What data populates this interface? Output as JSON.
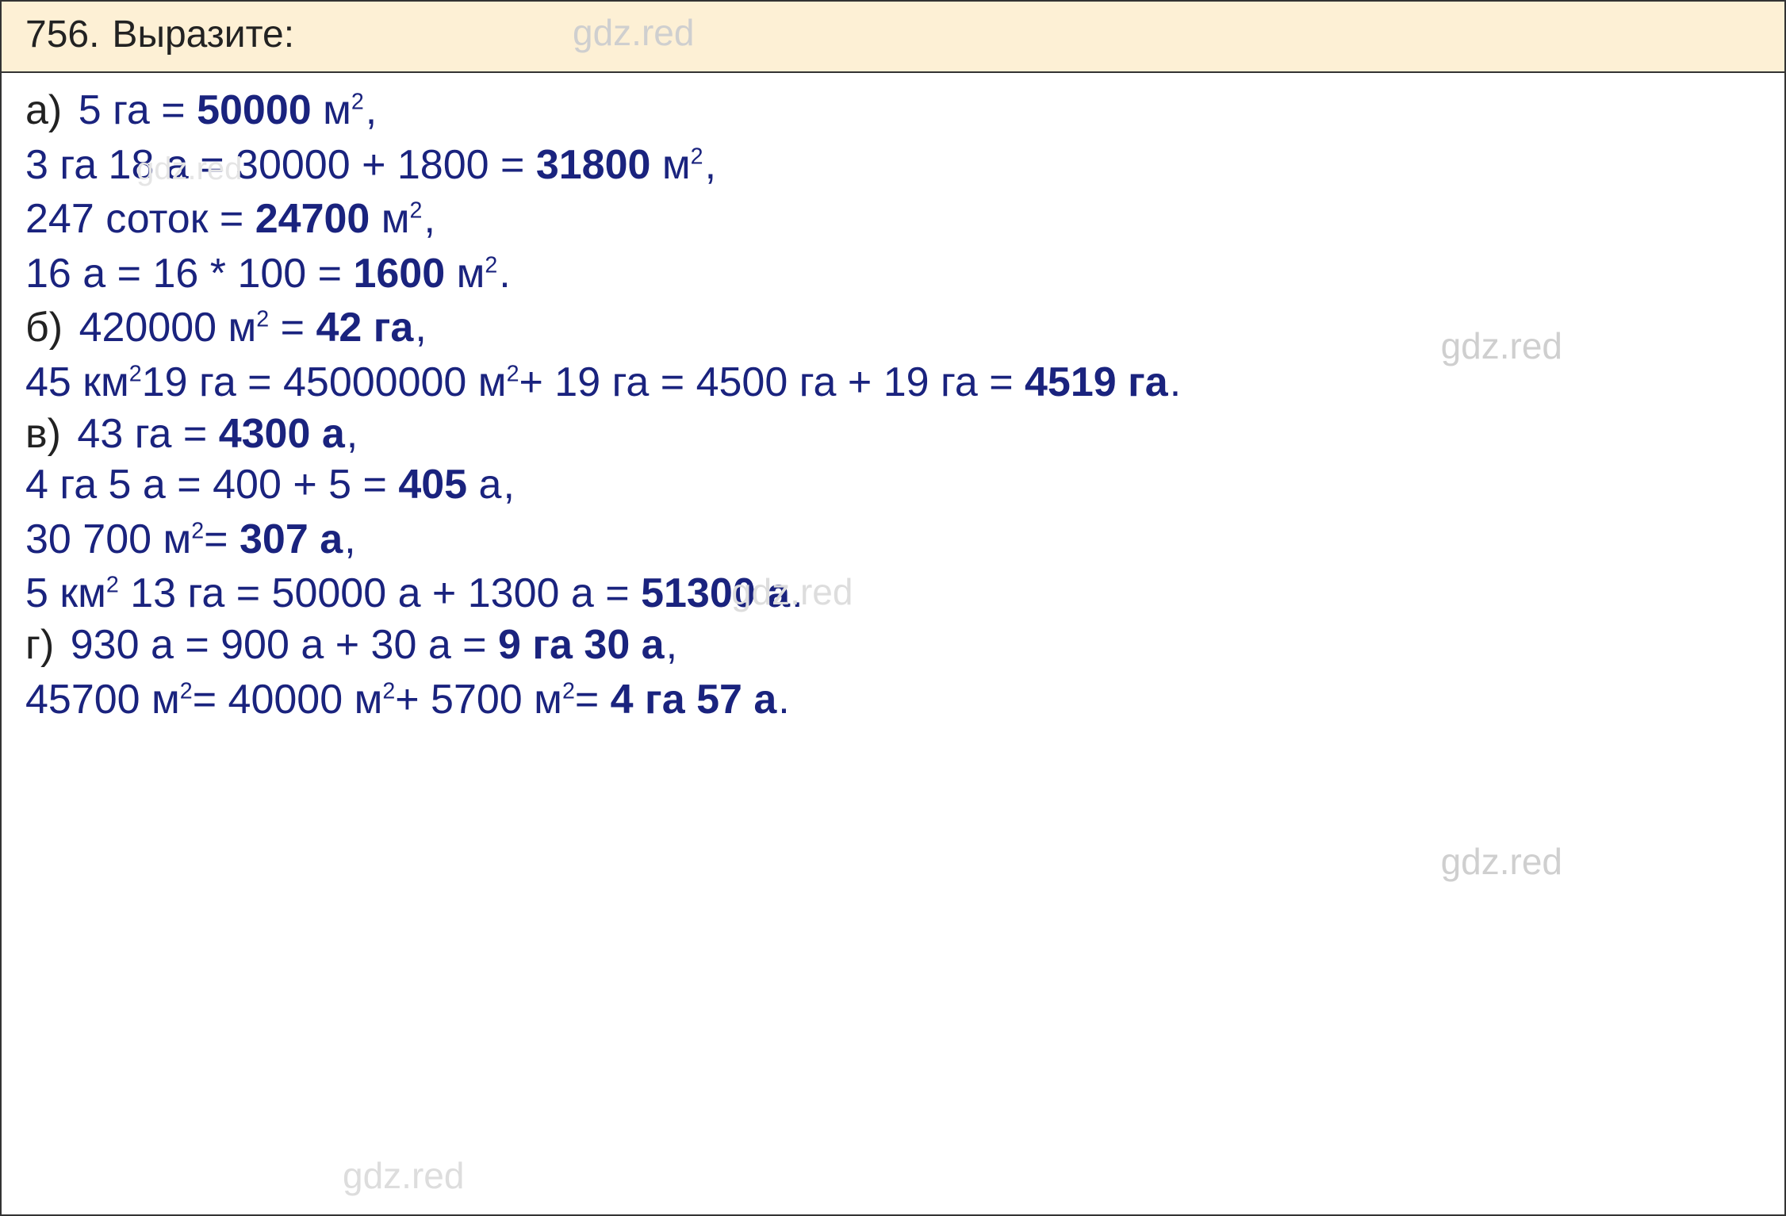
{
  "watermark": "gdz.red",
  "header": {
    "number": "756.",
    "title": "Выразите:"
  },
  "lines": {
    "a1_label": "а)",
    "a1": "5 га = ",
    "a1_bold": "50000",
    "a1_tail": " м",
    "a1_sup": "2",
    "a1_end": ",",
    "a2": "3 га 18 а = 30000 + 1800 = ",
    "a2_bold": "31800",
    "a2_tail": " м",
    "a2_sup": "2",
    "a2_end": ",",
    "a3": "247 соток = ",
    "a3_bold": "24700",
    "a3_tail": " м",
    "a3_sup": "2",
    "a3_end": ",",
    "a4": "16 а = 16 * 100 = ",
    "a4_bold": "1600",
    "a4_tail": " м",
    "a4_sup": "2",
    "a4_end": ".",
    "b1_label": "б)",
    "b1": "420000 м",
    "b1_sup": "2",
    "b1_mid": " = ",
    "b1_bold": "42 га",
    "b1_end": ",",
    "b2": "45 км",
    "b2_sup": "2",
    "b2_mid": "19 га = 45000000 м",
    "b2_sup2": "2",
    "b2_mid2": "+ 19 га = 4500 га + 19 га = ",
    "b2_bold": "4519 га",
    "b2_end": ".",
    "c1_label": "в)",
    "c1": "43 га = ",
    "c1_bold": "4300 а",
    "c1_end": ",",
    "c2": "4 га 5 а = 400 + 5 = ",
    "c2_bold": "405",
    "c2_tail": " а",
    "c2_end": ",",
    "c3": "30 700 м",
    "c3_sup": "2",
    "c3_mid": "= ",
    "c3_bold": "307 а",
    "c3_end": ",",
    "c4": "5 км",
    "c4_sup": "2",
    "c4_mid": " 13 га = 50000 а + 1300 а = ",
    "c4_bold": "51300 а",
    "c4_end": ".",
    "d1_label": "г)",
    "d1": "930 а = 900 а + 30 а = ",
    "d1_bold": "9 га 30 а",
    "d1_end": ",",
    "d2": "45700 м",
    "d2_sup": "2",
    "d2_mid": "= 40000 м",
    "d2_sup2": "2",
    "d2_mid2": "+ 5700 м",
    "d2_sup3": "2",
    "d2_mid3": "= ",
    "d2_bold": "4 га 57 а",
    "d2_end": "."
  }
}
